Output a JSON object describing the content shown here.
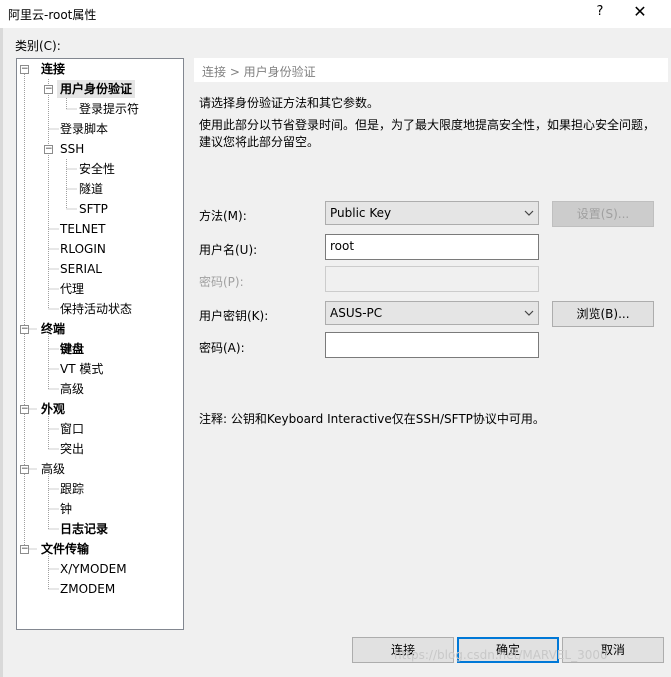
{
  "window": {
    "title": "阿里云-root属性",
    "help_glyph": "?",
    "close_glyph": "✕"
  },
  "category_label": "类别(C):",
  "tree": {
    "items": [
      {
        "label": "连接"
      },
      {
        "label": "用户身份验证"
      },
      {
        "label": "登录提示符"
      },
      {
        "label": "登录脚本"
      },
      {
        "label": "SSH"
      },
      {
        "label": "安全性"
      },
      {
        "label": "隧道"
      },
      {
        "label": "SFTP"
      },
      {
        "label": "TELNET"
      },
      {
        "label": "RLOGIN"
      },
      {
        "label": "SERIAL"
      },
      {
        "label": "代理"
      },
      {
        "label": "保持活动状态"
      },
      {
        "label": "终端"
      },
      {
        "label": "键盘"
      },
      {
        "label": "VT 模式"
      },
      {
        "label": "高级"
      },
      {
        "label": "外观"
      },
      {
        "label": "窗口"
      },
      {
        "label": "突出"
      },
      {
        "label": "高级"
      },
      {
        "label": "跟踪"
      },
      {
        "label": "钟"
      },
      {
        "label": "日志记录"
      },
      {
        "label": "文件传输"
      },
      {
        "label": "X/YMODEM"
      },
      {
        "label": "ZMODEM"
      }
    ]
  },
  "panel": {
    "breadcrumb": "连接 > 用户身份验证",
    "description1": "请选择身份验证方法和其它参数。",
    "description2": "使用此部分以节省登录时间。但是，为了最大限度地提高安全性，如果担心安全问题，建议您将此部分留空。",
    "method_label": "方法(M):",
    "method_value": "Public Key",
    "settings_button": "设置(S)...",
    "username_label": "用户名(U):",
    "username_value": "root",
    "password_label": "密码(P):",
    "userkey_label": "用户密钥(K):",
    "userkey_value": "ASUS-PC",
    "browse_button": "浏览(B)...",
    "passphrase_label": "密码(A):",
    "note": "注释: 公钥和Keyboard Interactive仅在SSH/SFTP协议中可用。"
  },
  "footer": {
    "connect_button": "连接",
    "ok_button": "确定",
    "cancel_button": "取消",
    "watermark": "https://blog.csdn.net/MARVEL_3000"
  }
}
